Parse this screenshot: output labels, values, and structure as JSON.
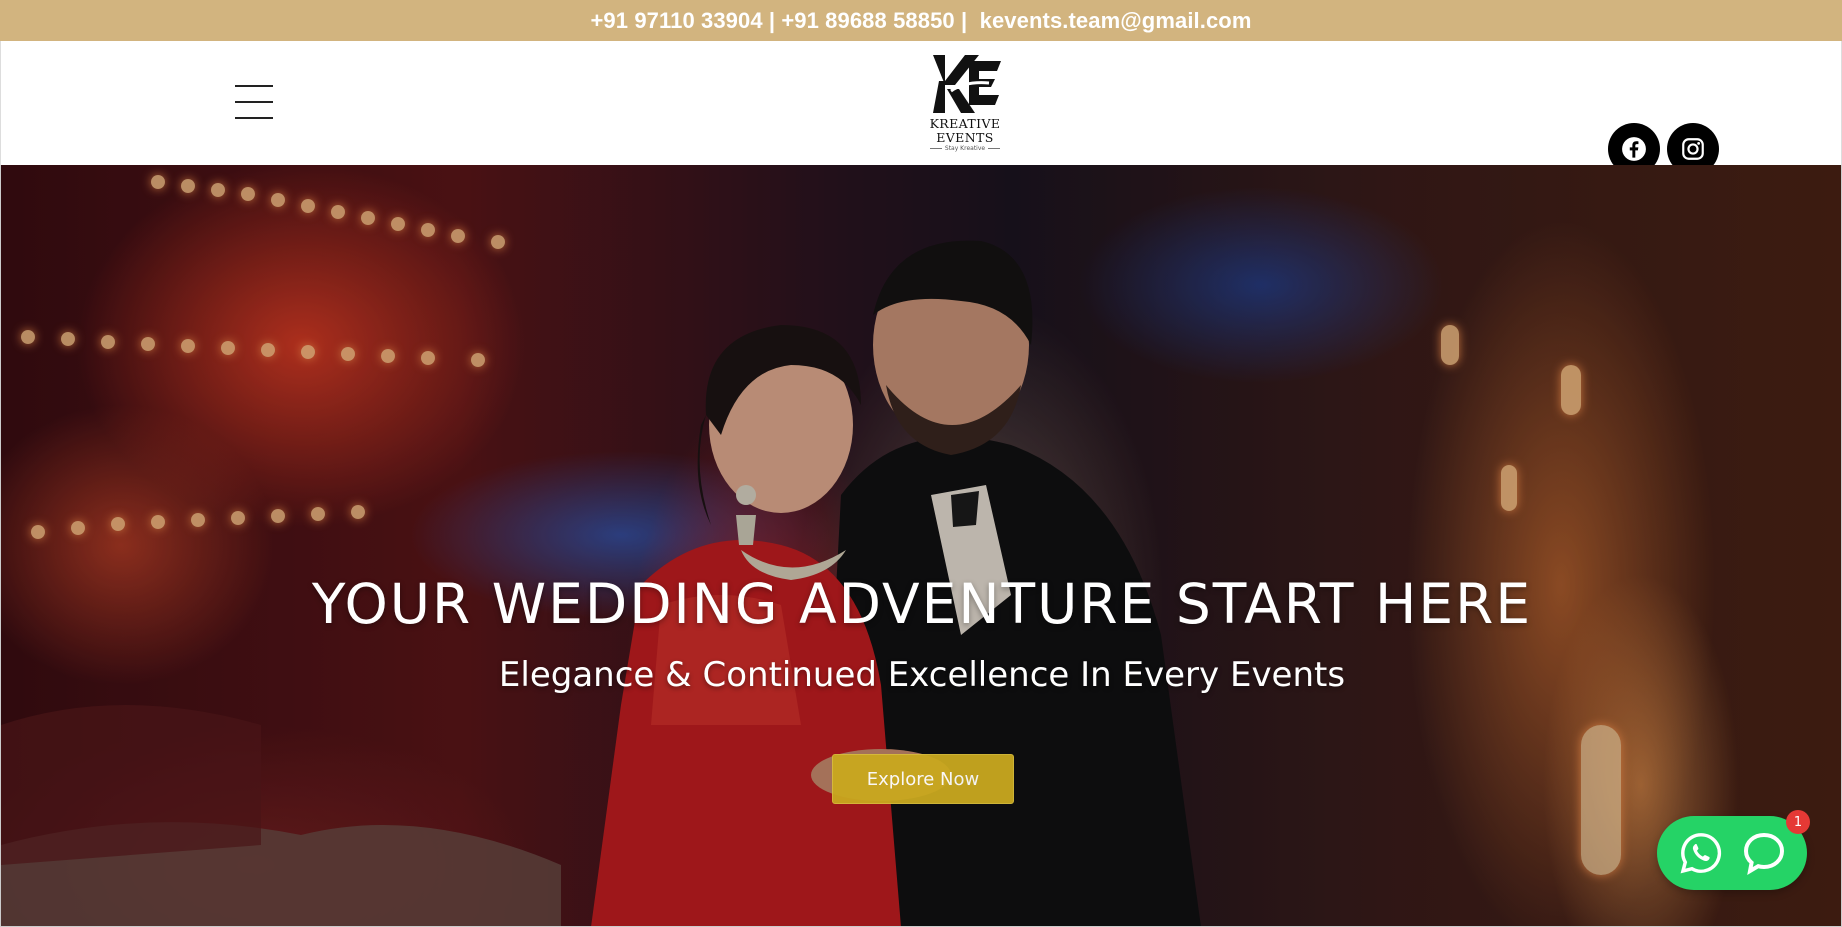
{
  "topbar": {
    "contact_line": "+91 97110 33904 | +91 89688 58850 |  kevents.team@gmail.com"
  },
  "header": {
    "logo": {
      "name": "KREATIVE EVENTS",
      "tagline": "Stay Kreative"
    },
    "menu_icon": "hamburger-icon",
    "social": [
      "facebook-icon",
      "instagram-icon"
    ]
  },
  "hero": {
    "title": "YOUR WEDDING ADVENTURE START HERE",
    "subtitle": "Elegance & Continued Excellence In Every Events",
    "cta_label": "Explore Now"
  },
  "chat_widget": {
    "buttons": [
      "whatsapp-icon",
      "chat-bubble-icon"
    ],
    "badge_count": "1",
    "color": "#25d366"
  },
  "colors": {
    "topbar": "#d2b47f",
    "cta": "#c9a81f",
    "social_bg": "#000000"
  }
}
